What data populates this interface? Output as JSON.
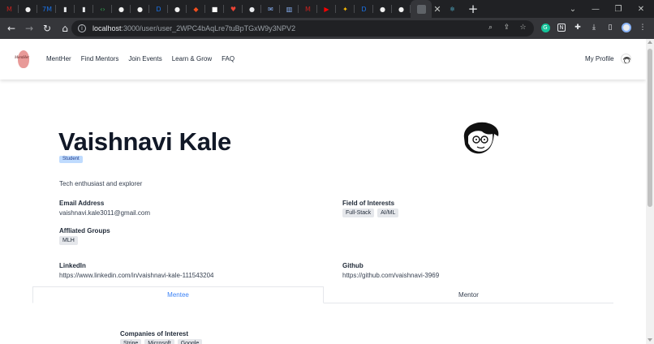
{
  "browser": {
    "tabs": [
      {
        "icon": "gmail-icon",
        "glyph": "M",
        "color": "#c5221f"
      },
      {
        "icon": "github-icon",
        "glyph": "●",
        "color": "#f0f0f0"
      },
      {
        "icon": "app-icon",
        "glyph": "7M",
        "color": "#1a73e8"
      },
      {
        "icon": "doc-icon",
        "glyph": "▮",
        "color": "#e8eaed"
      },
      {
        "icon": "file-icon",
        "glyph": "▮",
        "color": "#e8eaed"
      },
      {
        "icon": "code-icon",
        "glyph": "‹›",
        "color": "#34a853"
      },
      {
        "icon": "github-icon",
        "glyph": "●",
        "color": "#f0f0f0"
      },
      {
        "icon": "github-icon",
        "glyph": "●",
        "color": "#f0f0f0"
      },
      {
        "icon": "dev-icon",
        "glyph": "D",
        "color": "#1a73e8"
      },
      {
        "icon": "github-icon",
        "glyph": "●",
        "color": "#f0f0f0"
      },
      {
        "icon": "figma-icon",
        "glyph": "◆",
        "color": "#f24e1e"
      },
      {
        "icon": "page-icon",
        "glyph": "■",
        "color": "#ffffff"
      },
      {
        "icon": "heart-icon",
        "glyph": "♥",
        "color": "#ea4335"
      },
      {
        "icon": "globe-icon",
        "glyph": "●",
        "color": "#e8eaed"
      },
      {
        "icon": "mail-icon",
        "glyph": "✉",
        "color": "#8ab4f8"
      },
      {
        "icon": "chart-icon",
        "glyph": "▥",
        "color": "#8ab4f8"
      },
      {
        "icon": "gmail-icon",
        "glyph": "M",
        "color": "#c5221f"
      },
      {
        "icon": "youtube-icon",
        "glyph": "▶",
        "color": "#ff0000"
      },
      {
        "icon": "fire-icon",
        "glyph": "✦",
        "color": "#fbbc04"
      },
      {
        "icon": "dev-icon",
        "glyph": "D",
        "color": "#1a73e8"
      },
      {
        "icon": "github-icon",
        "glyph": "●",
        "color": "#f0f0f0"
      },
      {
        "icon": "github-icon",
        "glyph": "●",
        "color": "#f0f0f0"
      }
    ],
    "url_host": "localhost",
    "url_path": ":3000/user/user_2WPC4bAqLre7tuBpTGxW9y3NPV2"
  },
  "nav": {
    "logo_text": "MentHer",
    "links": [
      "MentHer",
      "Find Mentors",
      "Join Events",
      "Learn & Grow",
      "FAQ"
    ],
    "profile_label": "My Profile"
  },
  "profile": {
    "name": "Vaishnavi Kale",
    "role": "Student",
    "bio": "Tech enthusiast and explorer",
    "email_label": "Email Address",
    "email": "vaishnavi.kale3011@gmail.com",
    "interests_label": "Field of Interests",
    "interests": [
      "Full-Stack",
      "AI/ML"
    ],
    "groups_label": "Affliated Groups",
    "groups": [
      "MLH"
    ],
    "linkedin_label": "LinkedIn",
    "linkedin": "https://www.linkedin.com/in/vaishnavi-kale-111543204",
    "github_label": "Github",
    "github": "https://github.com/vaishnavi-3969"
  },
  "tabs": {
    "mentee": "Mentee",
    "mentor": "Mentor"
  },
  "mentee": {
    "companies_label": "Companies of Interest",
    "companies": [
      "Stripe",
      "Microsoft",
      "Google"
    ]
  }
}
